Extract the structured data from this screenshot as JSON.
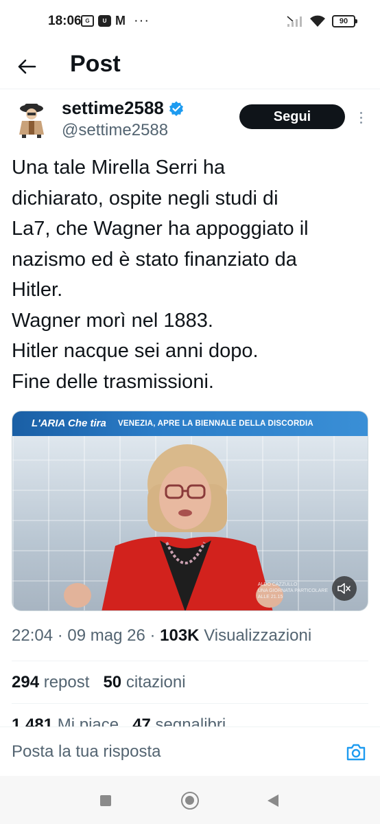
{
  "status_bar": {
    "time": "18:06",
    "battery": "90",
    "icons": [
      "gallery-icon",
      "app-icon",
      "gmail-icon",
      "more-dots-icon",
      "signal-icon",
      "wifi-icon",
      "battery-icon"
    ]
  },
  "header": {
    "title": "Post"
  },
  "author": {
    "name": "settime2588",
    "handle": "@settime2588",
    "verified": true,
    "follow_label": "Segui"
  },
  "tweet": {
    "lines": [
      "Una tale Mirella Serri ha",
      "dichiarato, ospite negli studi di",
      "La7, che Wagner ha appoggiato il",
      "nazismo ed è stato finanziato da",
      "Hitler.",
      "Wagner morì nel 1883.",
      "Hitler nacque sei anni dopo.",
      "Fine delle trasmissioni."
    ]
  },
  "media": {
    "banner_logo": "L'ARIA Che tira",
    "banner_text": "VENEZIA, APRE LA BIENNALE DELLA DISCORDIA",
    "caption_line1": "ALDO CAZZULLO",
    "caption_line2": "UNA GIORNATA PARTICOLARE",
    "caption_line3": "ALLE 21.15"
  },
  "meta": {
    "time": "22:04",
    "date": "09 mag 26",
    "views_count": "103K",
    "views_label": "Visualizzazioni"
  },
  "stats": {
    "reposts_count": "294",
    "reposts_label": "repost",
    "quotes_count": "50",
    "quotes_label": "citazioni",
    "likes_count": "1.481",
    "likes_label": "Mi piace",
    "bookmarks_count": "47",
    "bookmarks_label": "segnalibri"
  },
  "reply": {
    "placeholder": "Posta la tua risposta"
  },
  "colors": {
    "text": "#0f1419",
    "secondary": "#536471",
    "verified": "#1d9bf0",
    "follow_bg": "#0f1419"
  }
}
